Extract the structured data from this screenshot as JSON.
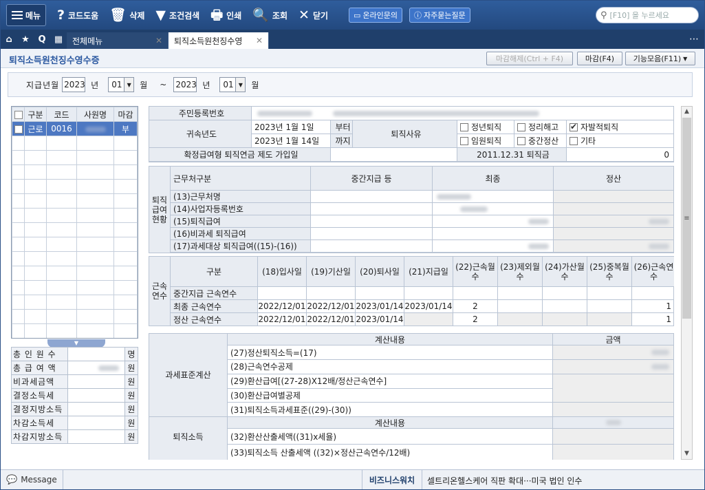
{
  "topbar": {
    "menu": "메뉴",
    "buttons": [
      {
        "icon": "?",
        "label": "코드도움"
      },
      {
        "icon": "🗑",
        "label": "삭제"
      },
      {
        "icon": "▼",
        "label": "조건검색"
      },
      {
        "icon": "🖶",
        "label": "인쇄"
      },
      {
        "icon": "🔍",
        "label": "조회"
      },
      {
        "icon": "✕",
        "label": "닫기"
      }
    ],
    "pills": [
      "온라인문의",
      "자주묻는질문"
    ],
    "search_placeholder": "[F10] 을 누르세요"
  },
  "tabs": {
    "all": "전체메뉴",
    "current": "퇴직소득원천징수영"
  },
  "page": {
    "title": "퇴직소득원천징수영수증",
    "btn_unclose": "마감해제(Ctrl + F4)",
    "btn_close": "마감(F4)",
    "btn_funcs": "기능모음(F11)"
  },
  "filter": {
    "label": "지급년월",
    "from_year": "2023",
    "from_month": "01",
    "to_year": "2023",
    "to_month": "01",
    "year_unit": "년",
    "month_unit": "월",
    "tilde": "~"
  },
  "emp_list": {
    "headers": [
      "구분",
      "코드",
      "사원명",
      "마감"
    ],
    "rows": [
      {
        "type": "근로",
        "code": "0016",
        "closed": "부"
      }
    ]
  },
  "summary": [
    {
      "label": "총 인 원 수",
      "unit": "명"
    },
    {
      "label": "총 급 여 액",
      "unit": "원"
    },
    {
      "label": "비과세금액",
      "unit": "원"
    },
    {
      "label": "결정소득세",
      "unit": "원"
    },
    {
      "label": "결정지방소득",
      "unit": "원"
    },
    {
      "label": "차감소득세",
      "unit": "원"
    },
    {
      "label": "차감지방소득",
      "unit": "원"
    }
  ],
  "form": {
    "resident_no": "주민등록번호",
    "year_label": "귀속년도",
    "date_from": "2023년 1월 1일",
    "date_to": "2023년 1월 14일",
    "from": "부터",
    "to": "까지",
    "reason": "퇴직사유",
    "reasons": [
      {
        "label": "정년퇴직",
        "checked": false
      },
      {
        "label": "정리해고",
        "checked": false
      },
      {
        "label": "자발적퇴직",
        "checked": true
      },
      {
        "label": "임원퇴직",
        "checked": false
      },
      {
        "label": "중간정산",
        "checked": false
      },
      {
        "label": "기타",
        "checked": false
      }
    ],
    "pension_join": "확정급여형 퇴직연금 제도 가입일",
    "severance_2011": "2011.12.31 퇴직금",
    "severance_2011_value": "0",
    "pay": {
      "side": "퇴직급여현황",
      "hdr": [
        "근무처구분",
        "중간지급 등",
        "최종",
        "정산"
      ],
      "rows": [
        "(13)근무처명",
        "(14)사업자등록번호",
        "(15)퇴직급여",
        "(16)비과세 퇴직급여",
        "(17)과세대상 퇴직급여((15)-(16))"
      ]
    },
    "svc": {
      "side": "근속연수",
      "hdr": [
        "구분",
        "(18)입사일",
        "(19)기산일",
        "(20)퇴사일",
        "(21)지급일",
        "(22)근속월수",
        "(23)제외월수",
        "(24)가산월수",
        "(25)중복월수",
        "(26)근속연수"
      ],
      "rows": [
        {
          "label": "중간지급 근속연수",
          "v": [
            "",
            "",
            "",
            "",
            "",
            "",
            "",
            "",
            ""
          ]
        },
        {
          "label": "최종 근속연수",
          "v": [
            "2022/12/01",
            "2022/12/01",
            "2023/01/14",
            "2023/01/14",
            "2",
            "",
            "",
            "",
            "1"
          ]
        },
        {
          "label": "정산 근속연수",
          "v": [
            "2022/12/01",
            "2022/12/01",
            "2023/01/14",
            "",
            "2",
            "",
            "",
            "",
            "1"
          ]
        }
      ]
    },
    "tax": {
      "side": "과세표준계산",
      "hdr": [
        "계산내용",
        "금액"
      ],
      "rows": [
        "(27)정산퇴직소득=(17)",
        "(28)근속연수공제",
        "(29)환산급여[(27-28)X12배/정산근속연수]",
        "(30)환산급여별공제",
        "(31)퇴직소득과세표준((29)-(30))"
      ]
    },
    "calc": {
      "side": "퇴직소득",
      "hdr": "계산내용",
      "rows": [
        "(32)환산산출세액((31)x세율)",
        "(33)퇴직소득 산출세액 ((32)×정산근속연수/12배)"
      ]
    }
  },
  "status": {
    "message": "Message",
    "biz": "비즈니스워치",
    "news": "셀트리온헬스케어 직판 확대···미국 법인 인수"
  }
}
